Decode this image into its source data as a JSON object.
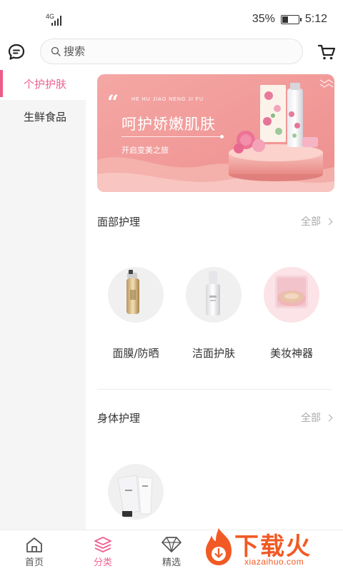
{
  "status_bar": {
    "network": "4G",
    "battery_percent": "35%",
    "battery_level": 0.35,
    "time": "5:12"
  },
  "header": {
    "search_placeholder": "搜索"
  },
  "sidebar": {
    "items": [
      {
        "label": "个护护肤",
        "active": true
      },
      {
        "label": "生鲜食品",
        "active": false
      }
    ]
  },
  "banner": {
    "subtitle_en": "HE HU JIAO NENG JI FU",
    "title": "呵护娇嫩肌肤",
    "tagline": "开启变美之旅"
  },
  "sections": [
    {
      "title": "面部护理",
      "more_label": "全部",
      "categories": [
        {
          "label": "面膜/防晒",
          "icon": "spray-bottle-image"
        },
        {
          "label": "洁面护肤",
          "icon": "serum-bottle-image"
        },
        {
          "label": "美妆神器",
          "icon": "cushion-compact-image"
        }
      ]
    },
    {
      "title": "身体护理",
      "more_label": "全部",
      "categories": [
        {
          "label": "",
          "icon": "body-lotion-tube-image"
        }
      ]
    }
  ],
  "tabbar": {
    "tabs": [
      {
        "label": "首页",
        "icon": "home-icon",
        "active": false
      },
      {
        "label": "分类",
        "icon": "layers-icon",
        "active": true
      },
      {
        "label": "精选",
        "icon": "diamond-icon",
        "active": false
      }
    ]
  },
  "watermark": {
    "text": "下载火",
    "url": "xiazaihuo.com"
  },
  "colors": {
    "accent": "#f06292",
    "banner_bg": "#f2a3a3",
    "watermark": "#f15a24"
  }
}
